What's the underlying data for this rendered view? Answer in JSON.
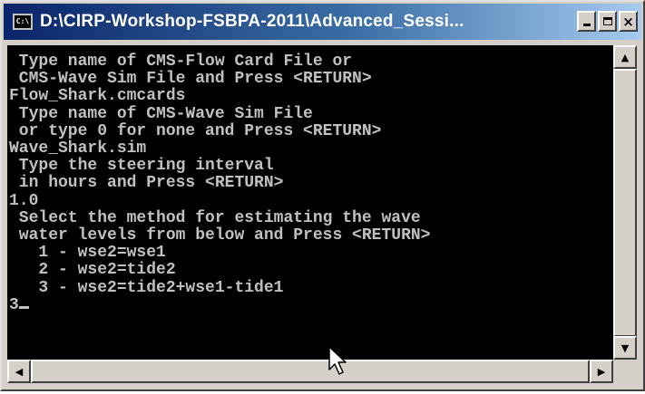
{
  "window": {
    "title": "D:\\CIRP-Workshop-FSBPA-2011\\Advanced_Sessi...",
    "icon": "console-icon",
    "icon_text": "C:\\"
  },
  "title_buttons": {
    "minimize": "minimize-icon",
    "maximize": "maximize-icon",
    "close": "close-icon",
    "close_glyph": "×"
  },
  "console": {
    "lines": [
      " Type name of CMS-Flow Card File or",
      " CMS-Wave Sim File and Press <RETURN>",
      "Flow_Shark.cmcards",
      " Type name of CMS-Wave Sim File",
      " or type 0 for none and Press <RETURN>",
      "Wave_Shark.sim",
      " Type the steering interval",
      " in hours and Press <RETURN>",
      "1.0",
      " Select the method for estimating the wave",
      " water levels from below and Press <RETURN>",
      "   1 - wse2=wse1",
      "   2 - wse2=tide2",
      "   3 - wse2=tide2+wse1-tide1"
    ],
    "input_value": "3"
  },
  "scrollbars": {
    "up_arrow": "▲",
    "down_arrow": "▼",
    "left_arrow": "◀",
    "right_arrow": "▶"
  }
}
